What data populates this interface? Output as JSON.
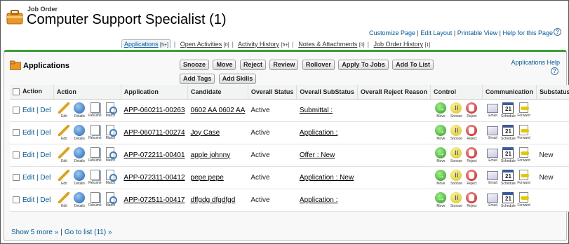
{
  "header": {
    "breadcrumb": "Job Order",
    "title": "Computer Support Specialist (1)",
    "links": [
      "Customize Page",
      "Edit Layout",
      "Printable View",
      "Help for this Page"
    ],
    "help_icon": "?"
  },
  "related_lists": [
    {
      "label": "Applications",
      "count": "[5+]",
      "active": true
    },
    {
      "label": "Open Activities",
      "count": "[0]",
      "active": false
    },
    {
      "label": "Activity History",
      "count": "[5+]",
      "active": false
    },
    {
      "label": "Notes & Attachments",
      "count": "[0]",
      "active": false
    },
    {
      "label": "Job Order History",
      "count": "[1]",
      "active": false
    }
  ],
  "panel": {
    "title": "Applications",
    "help_label": "Applications Help",
    "help_icon": "?",
    "accent_color": "#3c9c3c",
    "buttons": [
      "Snooze",
      "Move",
      "Reject",
      "Review",
      "Rollover",
      "Apply To Jobs",
      "Add To List",
      "Add Tags",
      "Add Skills"
    ]
  },
  "table": {
    "columns": [
      "Action",
      "Action",
      "Application",
      "Candidate",
      "Overall Status",
      "Overall SubStatus",
      "Overall Reject Reason",
      "Control",
      "Communication",
      "Substatus"
    ],
    "row_actions": {
      "edit": "Edit",
      "del": "Del"
    },
    "action_icons": [
      {
        "icon": "pencil-edit-icon",
        "label": "Edit"
      },
      {
        "icon": "info-details-icon",
        "label": "Details"
      },
      {
        "icon": "resume-document-icon",
        "label": "Résumé"
      },
      {
        "icon": "match-search-icon",
        "label": "Match"
      }
    ],
    "control_icons": [
      {
        "icon": "move-arrow-icon",
        "label": "Move",
        "glyph": "→"
      },
      {
        "icon": "snooze-pause-icon",
        "label": "Snooze",
        "glyph": "II"
      },
      {
        "icon": "reject-stop-icon",
        "label": "Reject",
        "glyph": ""
      }
    ],
    "communication_icons": [
      {
        "icon": "email-envelope-icon",
        "label": "Email",
        "glyph": ""
      },
      {
        "icon": "schedule-calendar-icon",
        "label": "Schedule",
        "glyph": "21"
      },
      {
        "icon": "forward-document-icon",
        "label": "Forward",
        "glyph": ""
      }
    ],
    "rows": [
      {
        "application": "APP-060211-00263",
        "candidate": "0602 AA 0602 AA",
        "overall_status": "Active",
        "overall_substatus": "Submittal :",
        "reject_reason": "",
        "substatus": ""
      },
      {
        "application": "APP-060711-00274",
        "candidate": "Joy Case",
        "overall_status": "Active",
        "overall_substatus": "Application :",
        "reject_reason": "",
        "substatus": ""
      },
      {
        "application": "APP-072211-00401",
        "candidate": "apple johnny",
        "overall_status": "Active",
        "overall_substatus": "Offer : New",
        "reject_reason": "",
        "substatus": "New"
      },
      {
        "application": "APP-072311-00412",
        "candidate": "pepe pepe",
        "overall_status": "Active",
        "overall_substatus": "Application : New",
        "reject_reason": "",
        "substatus": "New"
      },
      {
        "application": "APP-072511-00417",
        "candidate": "dffgdg dfgdfgd",
        "overall_status": "Active",
        "overall_substatus": "Application :",
        "reject_reason": "",
        "substatus": ""
      }
    ]
  },
  "footer": {
    "show_more": "Show 5 more »",
    "go_to_list": "Go to list (11) »"
  }
}
